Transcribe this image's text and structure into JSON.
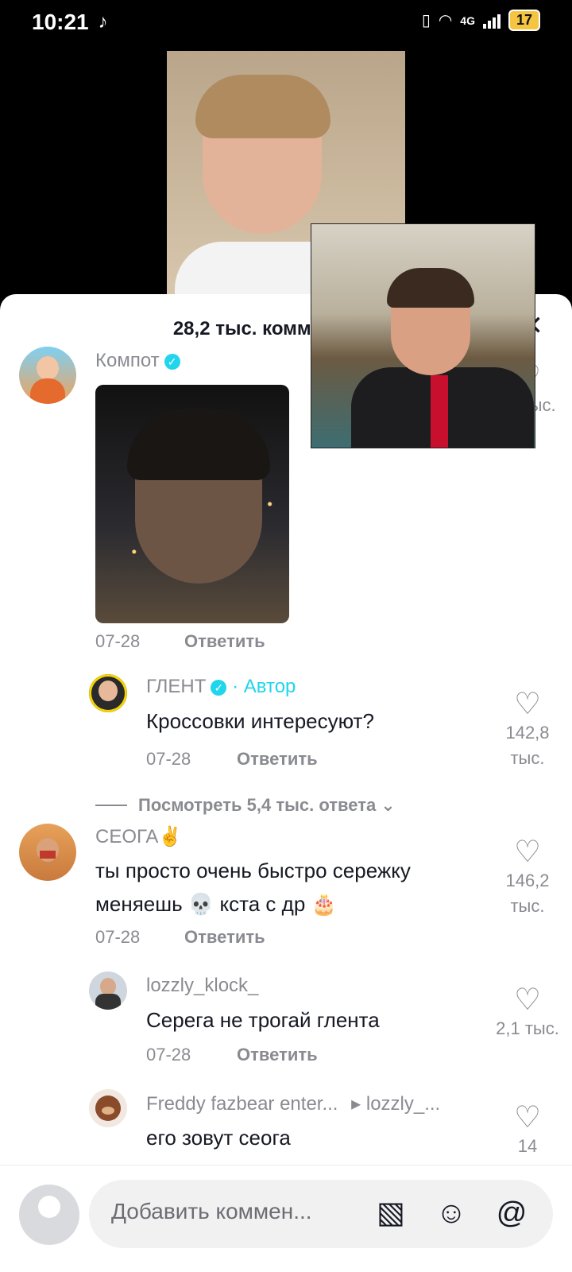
{
  "status_bar": {
    "time": "10:21",
    "network": "4G",
    "battery": "17"
  },
  "comments_header": {
    "title": "28,2 тыс. комментариев"
  },
  "comments": [
    {
      "name": "Компот",
      "date": "07-28",
      "reply_label": "Ответить",
      "likes": "… тыс."
    },
    {
      "name": "ГЛЕНТ",
      "author_label": "· Автор",
      "text": "Кроссовки интересуют?",
      "date": "07-28",
      "reply_label": "Ответить",
      "likes": "142,8 тыс."
    },
    {
      "name": "СЕОГА✌️",
      "text": "ты просто очень быстро сережку меняешь 💀 кста с др 🎂",
      "date": "07-28",
      "reply_label": "Ответить",
      "likes": "146,2 тыс."
    },
    {
      "name": "lozzly_klock_",
      "text": "Серега не трогай глента",
      "date": "07-28",
      "reply_label": "Ответить",
      "likes": "2,1 тыс."
    },
    {
      "name": "Freddy fazbear enter...",
      "reply_to": "▸ lozzly_...",
      "text": "его зовут сеога",
      "likes": "14"
    }
  ],
  "view_replies": "Посмотреть 5,4 тыс. ответа",
  "input": {
    "placeholder": "Добавить коммен..."
  },
  "icons": {
    "close": "close-icon",
    "heart": "heart-icon",
    "image": "image-icon",
    "emoji": "emoji-icon",
    "mention": "mention-icon"
  }
}
